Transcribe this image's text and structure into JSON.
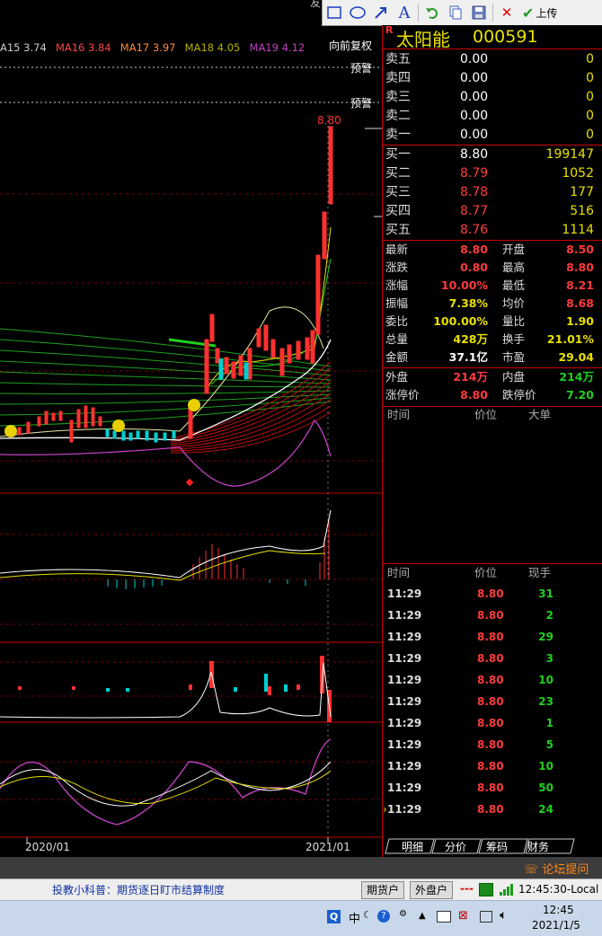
{
  "window_title_fragment": "友",
  "toolbar": {
    "upload_label": "上传"
  },
  "ma_legend": [
    {
      "label": "A15 3.74",
      "color": "#cccccc"
    },
    {
      "label": "MA16 3.84",
      "color": "#ff4444"
    },
    {
      "label": "MA17 3.97",
      "color": "#ff8a3a"
    },
    {
      "label": "MA18 4.05",
      "color": "#b0b000"
    },
    {
      "label": "MA19 4.12",
      "color": "#c040c0"
    }
  ],
  "chart": {
    "adjust_label": "向前复权",
    "alert1": "预警",
    "alert2": "预警",
    "peak_price": "8.80",
    "x_label_left": "2020/01",
    "x_label_right": "2021/01"
  },
  "stock": {
    "r_flag": "R",
    "name": "太阳能",
    "code": "000591"
  },
  "sell_orders": [
    {
      "label": "卖五",
      "price": "0.00",
      "vol": "0"
    },
    {
      "label": "卖四",
      "price": "0.00",
      "vol": "0"
    },
    {
      "label": "卖三",
      "price": "0.00",
      "vol": "0"
    },
    {
      "label": "卖二",
      "price": "0.00",
      "vol": "0"
    },
    {
      "label": "卖一",
      "price": "0.00",
      "vol": "0"
    }
  ],
  "buy_orders": [
    {
      "label": "买一",
      "price": "8.80",
      "vol": "199147"
    },
    {
      "label": "买二",
      "price": "8.79",
      "vol": "1052"
    },
    {
      "label": "买三",
      "price": "8.78",
      "vol": "177"
    },
    {
      "label": "买四",
      "price": "8.77",
      "vol": "516"
    },
    {
      "label": "买五",
      "price": "8.76",
      "vol": "1114"
    }
  ],
  "quote": [
    {
      "l1": "最新",
      "v1": "8.80",
      "l2": "开盘",
      "v2": "8.50"
    },
    {
      "l1": "涨跌",
      "v1": "0.80",
      "l2": "最高",
      "v2": "8.80"
    },
    {
      "l1": "涨幅",
      "v1": "10.00%",
      "l2": "最低",
      "v2": "8.21"
    },
    {
      "l1": "振幅",
      "v1": "7.38%",
      "l2": "均价",
      "v2": "8.68"
    },
    {
      "l1": "委比",
      "v1": "100.00%",
      "l2": "量比",
      "v2": "1.90"
    },
    {
      "l1": "总量",
      "v1": "428万",
      "l2": "换手",
      "v2": "21.01%"
    },
    {
      "l1": "金额",
      "v1": "37.1亿",
      "l2": "市盈",
      "v2": "29.04"
    }
  ],
  "quote2": [
    {
      "l1": "外盘",
      "v1": "214万",
      "l2": "内盘",
      "v2": "214万"
    },
    {
      "l1": "涨停价",
      "v1": "8.80",
      "l2": "跌停价",
      "v2": "7.20"
    }
  ],
  "big_orders_header": {
    "time": "时间",
    "price": "价位",
    "big": "大单"
  },
  "ticks_header": {
    "time": "时间",
    "price": "价位",
    "vol": "现手"
  },
  "ticks": [
    {
      "time": "11:29",
      "price": "8.80",
      "vol": "31"
    },
    {
      "time": "11:29",
      "price": "8.80",
      "vol": "2"
    },
    {
      "time": "11:29",
      "price": "8.80",
      "vol": "29"
    },
    {
      "time": "11:29",
      "price": "8.80",
      "vol": "3"
    },
    {
      "time": "11:29",
      "price": "8.80",
      "vol": "10"
    },
    {
      "time": "11:29",
      "price": "8.80",
      "vol": "23"
    },
    {
      "time": "11:29",
      "price": "8.80",
      "vol": "1"
    },
    {
      "time": "11:29",
      "price": "8.80",
      "vol": "5"
    },
    {
      "time": "11:29",
      "price": "8.80",
      "vol": "10"
    },
    {
      "time": "11:29",
      "price": "8.80",
      "vol": "50"
    },
    {
      "time": "11:29",
      "price": "8.80",
      "vol": "24"
    }
  ],
  "panel_tabs": [
    "明细",
    "分价",
    "筹码",
    "财务"
  ],
  "forum_link": "论坛提问",
  "statusbar": {
    "tip": "投教小科普：期货逐日盯市结算制度",
    "btn1": "期货户",
    "btn2": "外盘户",
    "dashes": "---",
    "clock": "12:45:30-Local"
  },
  "taskbar": {
    "ime": "中",
    "time": "12:45",
    "date": "2021/1/5"
  }
}
